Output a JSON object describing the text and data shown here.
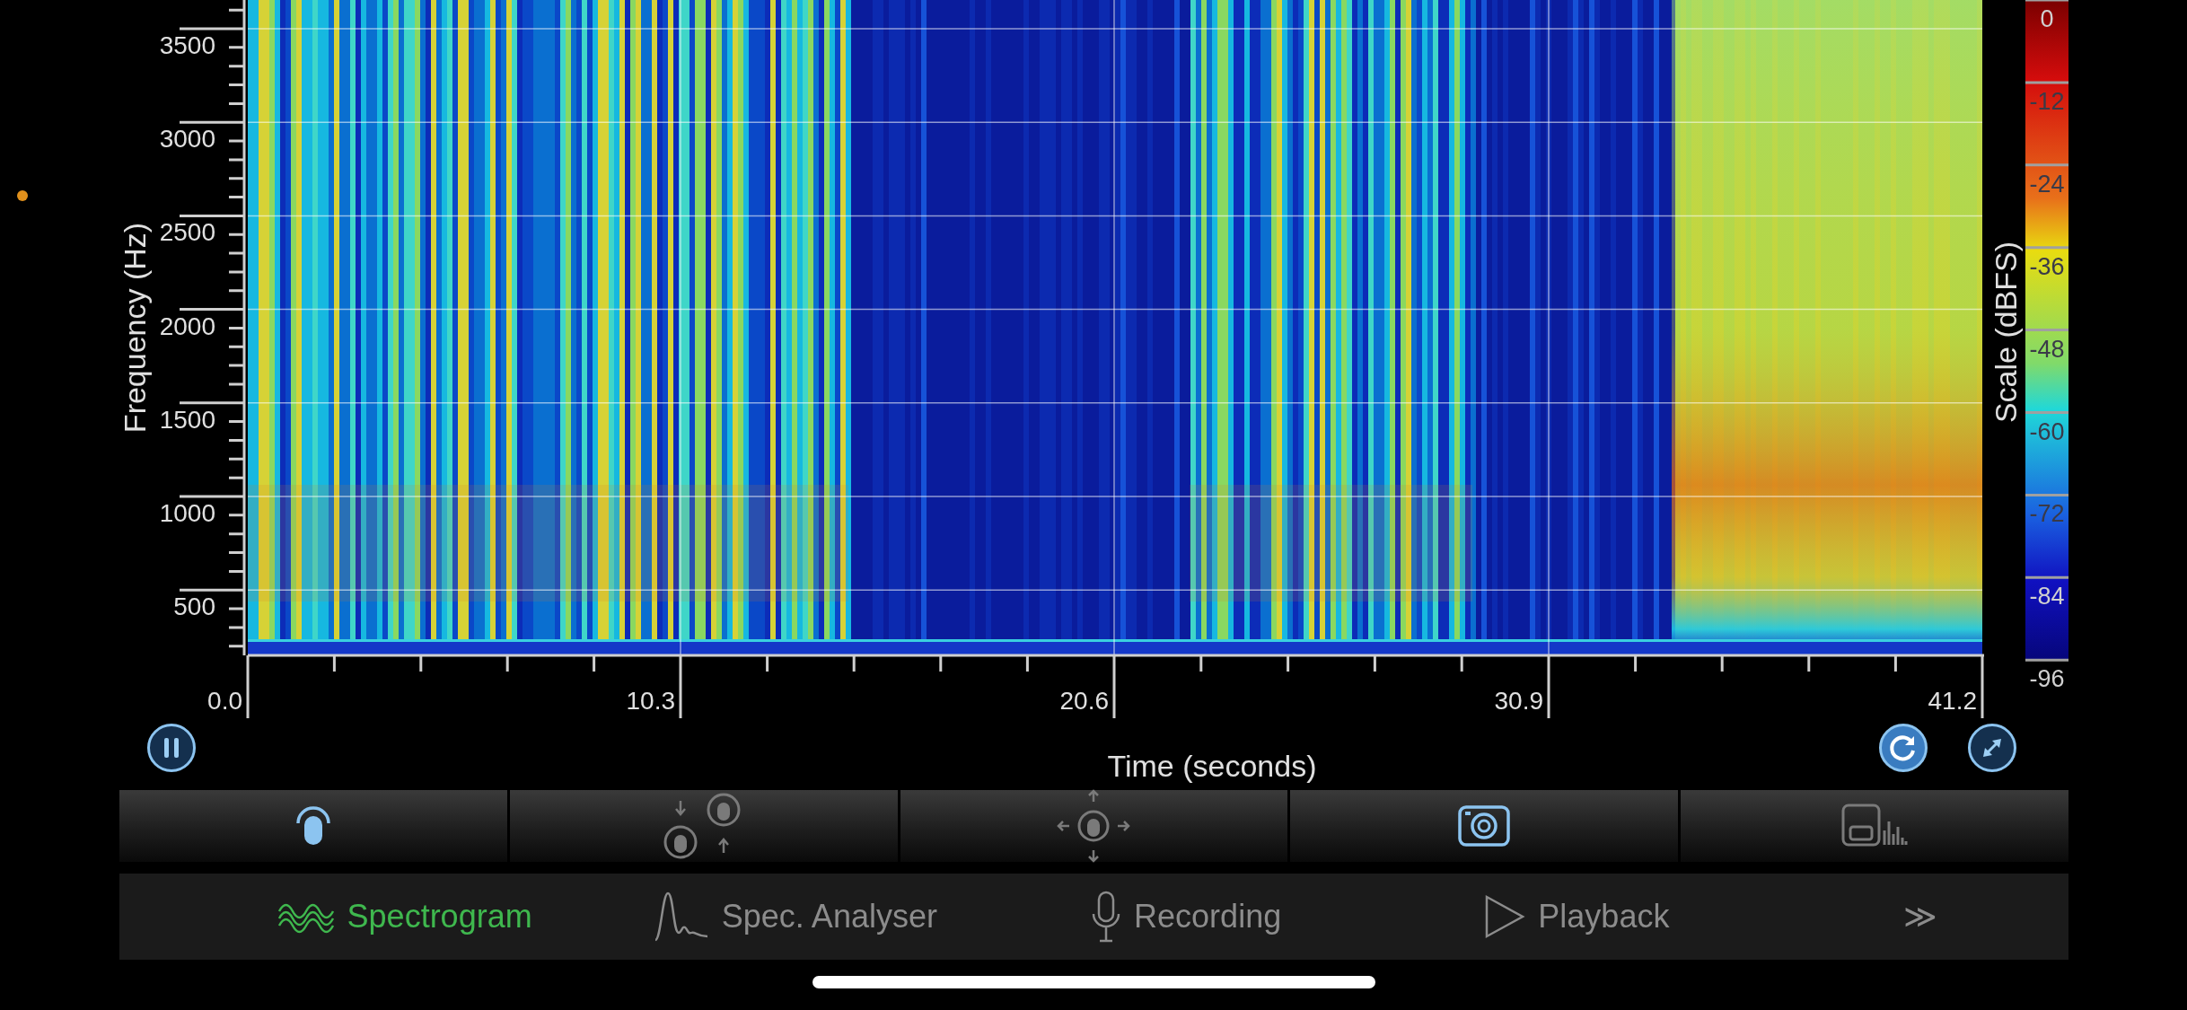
{
  "y_axis": {
    "title": "Frequency (Hz)",
    "ticks": [
      "3500",
      "3000",
      "2500",
      "2000",
      "1500",
      "1000",
      "500"
    ]
  },
  "x_axis": {
    "title": "Time (seconds)",
    "ticks": [
      "0.0",
      "10.3",
      "20.6",
      "30.9",
      "41.2"
    ]
  },
  "scale": {
    "title": "Scale (dBFS)",
    "ticks": [
      "0",
      "-12",
      "-24",
      "-36",
      "-48",
      "-60",
      "-72",
      "-84",
      "-96"
    ]
  },
  "tools": [
    {
      "kind": "tap",
      "active": true
    },
    {
      "kind": "zoom",
      "active": false
    },
    {
      "kind": "pan",
      "active": false
    },
    {
      "kind": "camera",
      "active": true
    },
    {
      "kind": "save",
      "active": false
    }
  ],
  "tabs": [
    {
      "kind": "spectrogram",
      "label": "Spectrogram",
      "selected": true
    },
    {
      "kind": "analyser",
      "label": "Spec. Analyser",
      "selected": false
    },
    {
      "kind": "recording",
      "label": "Recording",
      "selected": false
    },
    {
      "kind": "playback",
      "label": "Playback",
      "selected": false
    },
    {
      "kind": "more",
      "label": "≫",
      "selected": false
    }
  ]
}
